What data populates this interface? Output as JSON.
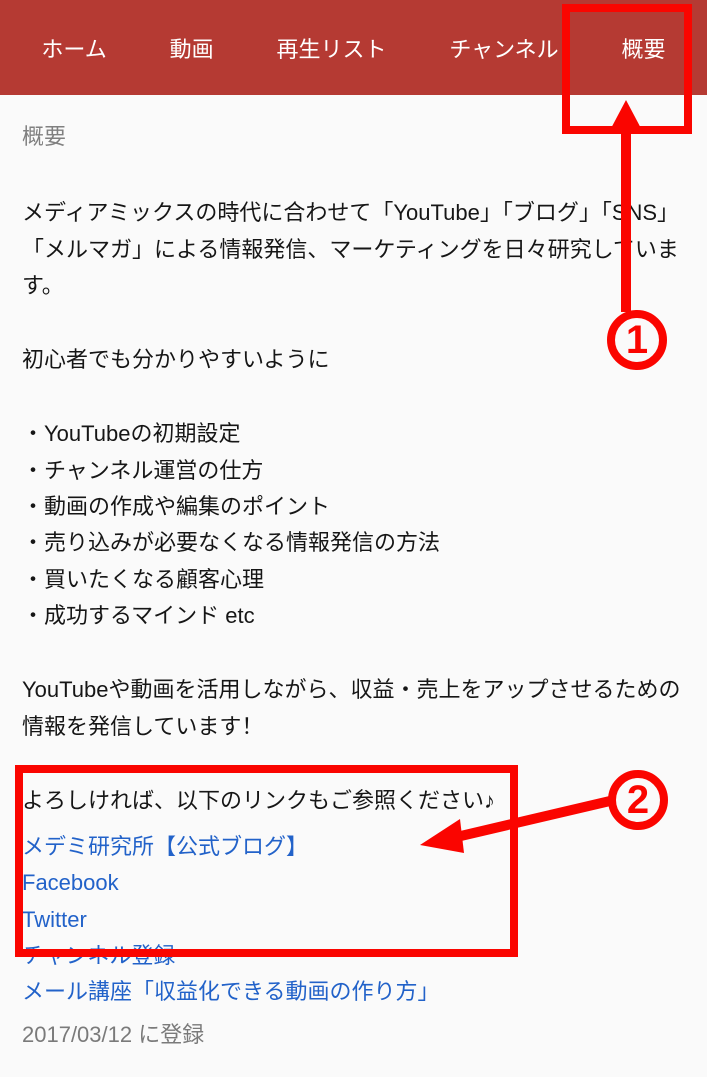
{
  "tabs": {
    "home": "ホーム",
    "videos": "動画",
    "playlists": "再生リスト",
    "channels": "チャンネル",
    "about": "概要"
  },
  "about": {
    "section_title": "概要",
    "intro": "メディアミックスの時代に合わせて「YouTube」「ブログ」「SNS」「メルマガ」による情報発信、マーケティングを日々研究しています。",
    "lead_in": "初心者でも分かりやすいように",
    "bullets": [
      "YouTubeの初期設定",
      "チャンネル運営の仕方",
      "動画の作成や編集のポイント",
      "売り込みが必要なくなる情報発信の方法",
      "買いたくなる顧客心理",
      "成功するマインド etc"
    ],
    "summary": "YouTubeや動画を活用しながら、収益・売上をアップさせるための情報を発信しています！",
    "link_prompt": "よろしければ、以下のリンクもご参照ください♪",
    "links": [
      "メデミ研究所【公式ブログ】",
      "Facebook",
      "Twitter",
      "チャンネル登録",
      "メール講座「収益化できる動画の作り方」"
    ],
    "registered": "2017/03/12 に登録"
  },
  "annotations": {
    "marker1": "1",
    "marker2": "2"
  }
}
